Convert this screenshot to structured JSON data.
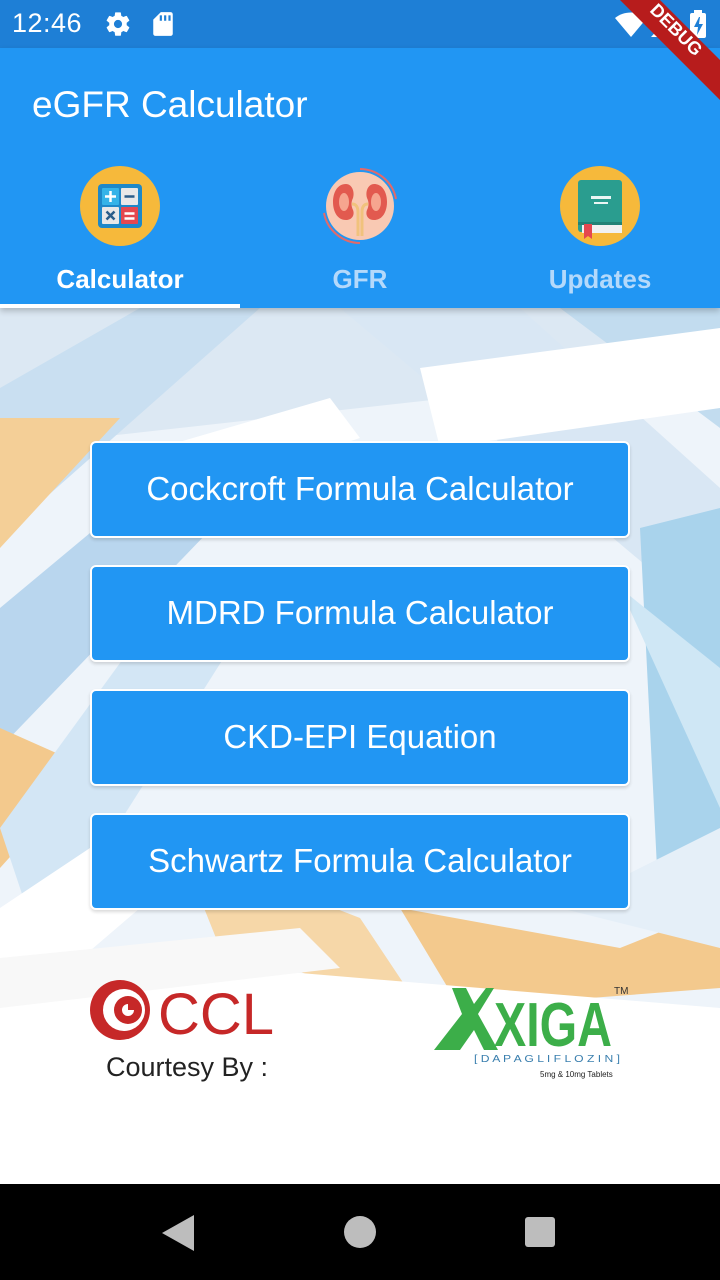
{
  "status_bar": {
    "time": "12:46",
    "icons": [
      "gear-icon",
      "sd-card-icon",
      "wifi-icon",
      "signal-icon",
      "battery-charging-icon"
    ]
  },
  "app_bar": {
    "title": "eGFR Calculator",
    "color": "#2196f3"
  },
  "tabs": [
    {
      "label": "Calculator",
      "icon": "calculator-icon",
      "active": true
    },
    {
      "label": "GFR",
      "icon": "kidney-icon",
      "active": false
    },
    {
      "label": "Updates",
      "icon": "book-icon",
      "active": false
    }
  ],
  "menu": {
    "buttons": [
      {
        "label": "Cockcroft Formula Calculator"
      },
      {
        "label": "MDRD Formula Calculator"
      },
      {
        "label": "CKD-EPI Equation"
      },
      {
        "label": "Schwartz Formula Calculator"
      }
    ]
  },
  "footer": {
    "ccl_logo_text": "CCL",
    "courtesy": "Courtesy By :",
    "xiga_logo": {
      "brand": "XIGA",
      "tm": "TM",
      "generic": "[ D A P A G L I F L O Z I N ]",
      "strength": "5mg & 10mg Tablets"
    }
  },
  "debug_banner": "DEBUG",
  "colors": {
    "status_bar": "#1e7fd6",
    "primary": "#2196f3",
    "inactive_tab": "#b4d9fb"
  }
}
